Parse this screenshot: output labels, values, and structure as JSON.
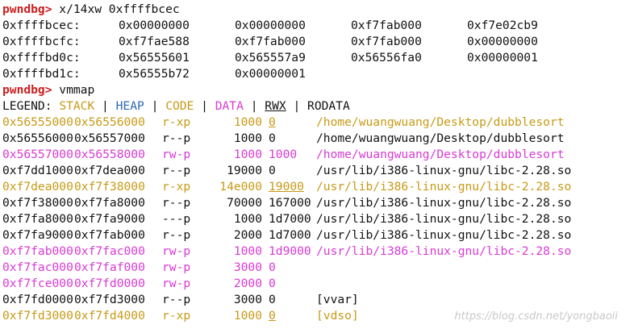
{
  "colors": {
    "prompt": "#cc1f1f",
    "text": "#111111",
    "stack": "#c79a17",
    "heap": "#2a6ab5",
    "code": "#c79a17",
    "data": "#d83ad3",
    "rwx": "#111111",
    "rodata": "#111111"
  },
  "prompt1": {
    "prompt": "pwndbg>",
    "command": " x/14xw 0xffffbcec"
  },
  "memory": [
    {
      "addr": "0xffffbcec:",
      "words": [
        "0x00000000",
        "0x00000000",
        "0xf7fab000",
        "0xf7e02cb9"
      ]
    },
    {
      "addr": "0xffffbcfc:",
      "words": [
        "0xf7fae588",
        "0xf7fab000",
        "0xf7fab000",
        "0x00000000"
      ]
    },
    {
      "addr": "0xffffbd0c:",
      "words": [
        "0x56555601",
        "0x565557a9",
        "0x56556fa0",
        "0x00000001"
      ]
    },
    {
      "addr": "0xffffbd1c:",
      "words": [
        "0x56555b72",
        "0x00000001"
      ]
    }
  ],
  "prompt2": {
    "prompt": "pwndbg>",
    "command": " vmmap"
  },
  "legend": {
    "label": "LEGEND:",
    "sep": "|",
    "stack": "STACK",
    "heap": "HEAP",
    "code": "CODE",
    "data": "DATA",
    "rwx": "RWX",
    "rodata": "RODATA"
  },
  "mappings": [
    {
      "start": "0x56555000",
      "end": "0x56556000",
      "perm": "r-xp",
      "size": "1000",
      "offset": "0",
      "path": "/home/wuangwuang/Desktop/dubblesort",
      "kind": "code"
    },
    {
      "start": "0x56556000",
      "end": "0x56557000",
      "perm": "r--p",
      "size": "1000",
      "offset": "0",
      "path": "/home/wuangwuang/Desktop/dubblesort",
      "kind": "plain"
    },
    {
      "start": "0x56557000",
      "end": "0x56558000",
      "perm": "rw-p",
      "size": "1000",
      "offset": "1000",
      "path": "/home/wuangwuang/Desktop/dubblesort",
      "kind": "data"
    },
    {
      "start": "0xf7dd1000",
      "end": "0xf7dea000",
      "perm": "r--p",
      "size": "19000",
      "offset": "0",
      "path": "/usr/lib/i386-linux-gnu/libc-2.28.so",
      "kind": "plain"
    },
    {
      "start": "0xf7dea000",
      "end": "0xf7f38000",
      "perm": "r-xp",
      "size": "14e000",
      "offset": "19000",
      "path": "/usr/lib/i386-linux-gnu/libc-2.28.so",
      "kind": "code"
    },
    {
      "start": "0xf7f38000",
      "end": "0xf7fa8000",
      "perm": "r--p",
      "size": "70000",
      "offset": "167000",
      "path": "/usr/lib/i386-linux-gnu/libc-2.28.so",
      "kind": "plain"
    },
    {
      "start": "0xf7fa8000",
      "end": "0xf7fa9000",
      "perm": "---p",
      "size": "1000",
      "offset": "1d7000",
      "path": "/usr/lib/i386-linux-gnu/libc-2.28.so",
      "kind": "plain"
    },
    {
      "start": "0xf7fa9000",
      "end": "0xf7fab000",
      "perm": "r--p",
      "size": "2000",
      "offset": "1d7000",
      "path": "/usr/lib/i386-linux-gnu/libc-2.28.so",
      "kind": "plain"
    },
    {
      "start": "0xf7fab000",
      "end": "0xf7fac000",
      "perm": "rw-p",
      "size": "1000",
      "offset": "1d9000",
      "path": "/usr/lib/i386-linux-gnu/libc-2.28.so",
      "kind": "data"
    },
    {
      "start": "0xf7fac000",
      "end": "0xf7faf000",
      "perm": "rw-p",
      "size": "3000",
      "offset": "0",
      "path": "",
      "kind": "data"
    },
    {
      "start": "0xf7fce000",
      "end": "0xf7fd0000",
      "perm": "rw-p",
      "size": "2000",
      "offset": "0",
      "path": "",
      "kind": "data"
    },
    {
      "start": "0xf7fd0000",
      "end": "0xf7fd3000",
      "perm": "r--p",
      "size": "3000",
      "offset": "0",
      "path": "[vvar]",
      "kind": "plain"
    },
    {
      "start": "0xf7fd3000",
      "end": "0xf7fd4000",
      "perm": "r-xp",
      "size": "1000",
      "offset": "0",
      "path": "[vdso]",
      "kind": "code"
    }
  ],
  "watermark": "https://blog.csdn.net/yongbaoii"
}
